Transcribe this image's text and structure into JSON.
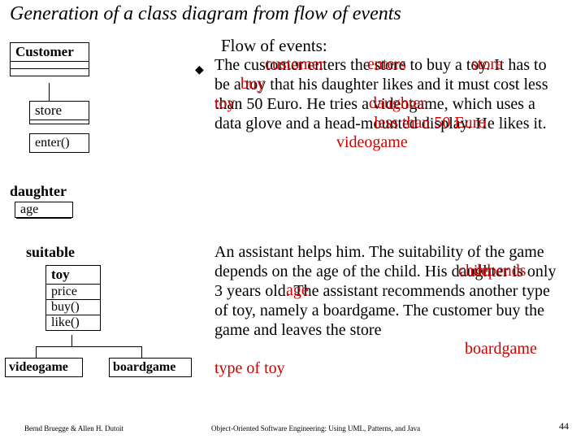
{
  "title": "Generation of a class diagram from flow of events",
  "left": {
    "customer": "Customer",
    "store": "store",
    "enter": "enter()",
    "daughter": "daughter",
    "age": "age",
    "suitable": "suitable",
    "toy": "toy",
    "price": "price",
    "buy": "buy()",
    "like": "like()",
    "videogame": "videogame",
    "boardgame": "boardgame"
  },
  "flow": {
    "heading": "Flow of events:",
    "p1": "The customer enters the store to buy a toy. It has to be a toy that his daughter likes and it must cost less than 50 Euro. He tries a videogame, which uses a data glove and a head-mounted display. He likes it.",
    "p2": "An assistant helps him. The suitability of the game depends on the age of the child. His daughter is only 3 years old. The assistant recommends another type of toy, namely a boardgame. The customer buy the game and leaves the store"
  },
  "overlays": {
    "customer": "customer",
    "enters": "enters",
    "store": "store",
    "buy": "buy",
    "toy": "toy",
    "daughter": "daughter",
    "less50": "less than 50 Euro",
    "videogame": "videogame",
    "depends": "depends",
    "age": "age",
    "child": "child",
    "boardgame": "boardgame",
    "typeoftoy": "type of toy"
  },
  "footer": {
    "left": "Bernd Bruegge & Allen H. Dutoit",
    "mid": "Object-Oriented Software Engineering: Using UML, Patterns, and Java",
    "page": "44"
  },
  "bullet": "◆"
}
